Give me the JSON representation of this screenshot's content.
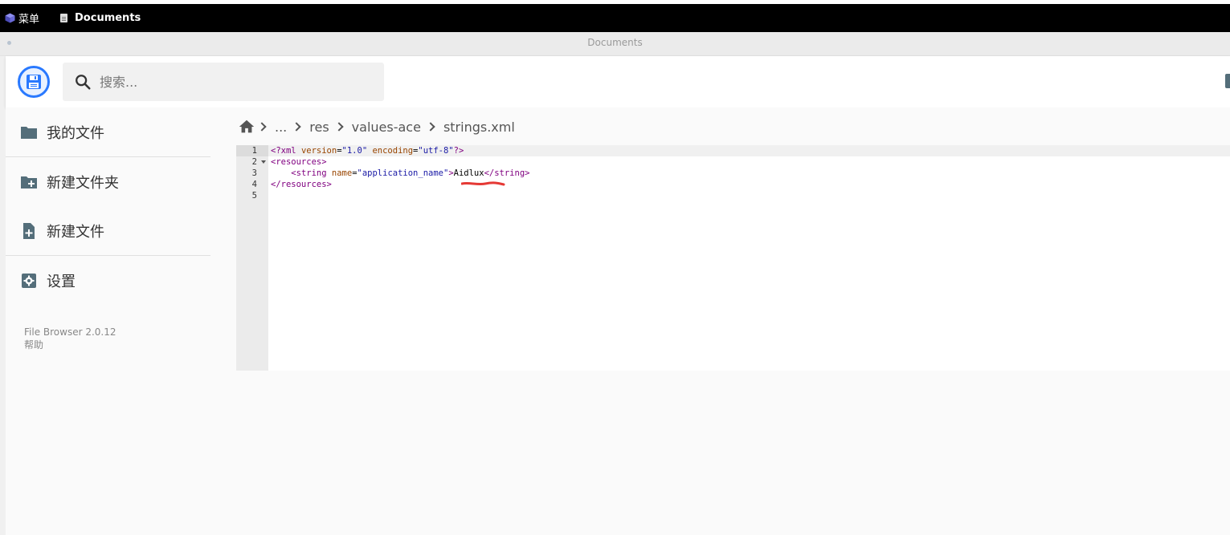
{
  "taskbar": {
    "menu_label": "菜单",
    "documents_label": "Documents"
  },
  "window": {
    "title": "Documents"
  },
  "header": {
    "search_placeholder": "搜索..."
  },
  "sidebar": {
    "items": [
      {
        "label": "我的文件",
        "icon": "folder-icon"
      },
      {
        "label": "新建文件夹",
        "icon": "folder-plus-icon"
      },
      {
        "label": "新建文件",
        "icon": "file-plus-icon"
      },
      {
        "label": "设置",
        "icon": "settings-icon"
      }
    ],
    "version": "File Browser 2.0.12",
    "help": "帮助"
  },
  "breadcrumbs": {
    "home_icon": "home-icon",
    "items": [
      "...",
      "res",
      "values-ace",
      "strings.xml"
    ]
  },
  "editor": {
    "line_numbers": [
      "1",
      "2",
      "3",
      "4",
      "5"
    ],
    "lines": [
      {
        "parts": [
          [
            "decl",
            "<?xml"
          ],
          [
            "plain",
            " "
          ],
          [
            "attr",
            "version"
          ],
          [
            "plain",
            "="
          ],
          [
            "str",
            "\"1.0\""
          ],
          [
            "plain",
            " "
          ],
          [
            "attr",
            "encoding"
          ],
          [
            "plain",
            "="
          ],
          [
            "str",
            "\"utf-8\""
          ],
          [
            "decl",
            "?>"
          ]
        ]
      },
      {
        "parts": [
          [
            "tag",
            "<resources>"
          ]
        ]
      },
      {
        "parts": [
          [
            "plain",
            "    "
          ],
          [
            "tag",
            "<string"
          ],
          [
            "plain",
            " "
          ],
          [
            "attr",
            "name"
          ],
          [
            "plain",
            "="
          ],
          [
            "str",
            "\"application_name\""
          ],
          [
            "tag",
            ">"
          ],
          [
            "plain",
            "Aidlux"
          ],
          [
            "tag",
            "</string>"
          ]
        ]
      },
      {
        "parts": [
          [
            "tag",
            "</resources>"
          ]
        ]
      },
      {
        "parts": []
      }
    ]
  },
  "colors": {
    "accent": "#2979ff",
    "annotation": "#e53935"
  }
}
